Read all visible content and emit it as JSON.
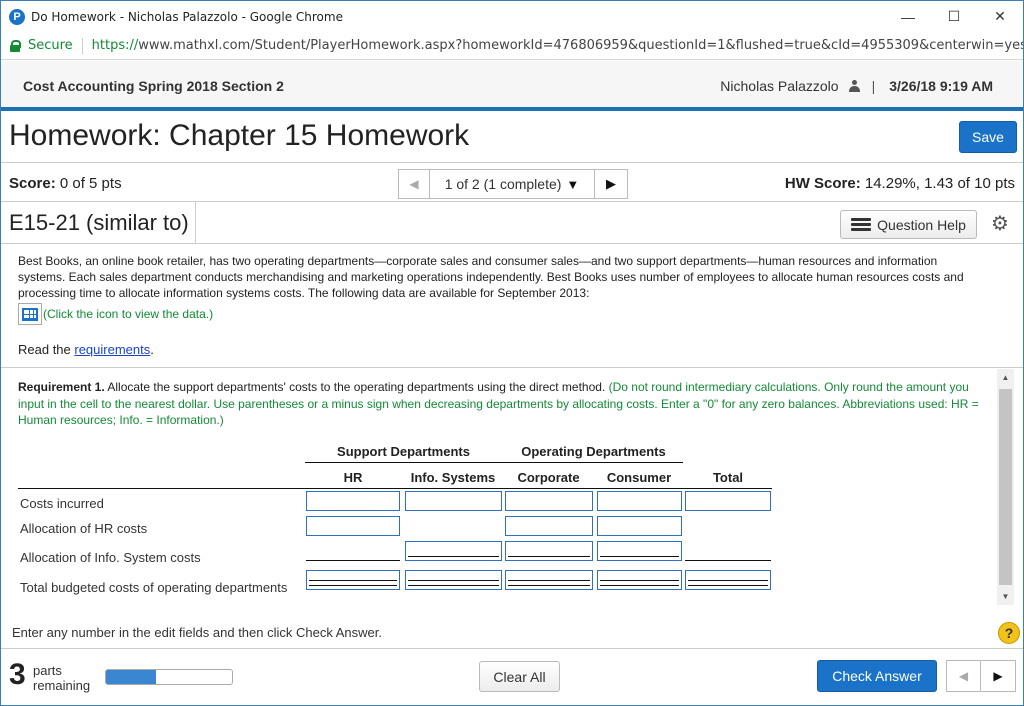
{
  "browser": {
    "window_title": "Do Homework - Nicholas Palazzolo - Google Chrome",
    "secure_label": "Secure",
    "url_scheme": "https://",
    "url_rest": "www.mathxl.com/Student/PlayerHomework.aspx?homeworkId=476806959&questionId=1&flushed=true&cId=4955309&centerwin=yes",
    "minimize_glyph": "—",
    "maximize_glyph": "☐",
    "close_glyph": "✕"
  },
  "header": {
    "course": "Cost Accounting Spring 2018 Section 2",
    "user": "Nicholas Palazzolo",
    "separator": "|",
    "datetime": "3/26/18 9:19 AM"
  },
  "homework": {
    "title": "Homework: Chapter 15 Homework",
    "save_label": "Save",
    "score_label": "Score:",
    "score_value": "0 of 5 pts",
    "nav_position": "1 of 2 (1 complete)",
    "hw_score_label": "HW Score:",
    "hw_score_value": "14.29%, 1.43 of 10 pts",
    "question_id": "E15-21 (similar to)",
    "question_help_label": "Question Help"
  },
  "question": {
    "intro": "Best Books, an online book retailer, has two operating departments—corporate sales and consumer sales—and two support departments—human resources and information systems. Each sales department conducts merchandising and marketing operations independently. Best Books uses number of employees to allocate human resources costs and processing time to allocate information systems costs. The following data are available for September 2013:",
    "data_link": "(Click the icon to view the data.)",
    "read_prefix": "Read the ",
    "requirements_link": "requirements",
    "read_suffix": ".",
    "req_label": "Requirement 1.",
    "req_text": " Allocate the support departments' costs to the operating departments using the direct method. ",
    "req_note": "(Do not round intermediary calculations. Only round the amount you input in the cell to the nearest dollar. Use parentheses or a minus sign when decreasing departments by allocating costs. Enter a \"0\" for any zero balances. Abbreviations used: HR = Human resources; Info. = Information.)"
  },
  "table": {
    "group_support": "Support Departments",
    "group_operating": "Operating Departments",
    "columns": [
      "HR",
      "Info. Systems",
      "Corporate",
      "Consumer",
      "Total"
    ],
    "rows": [
      "Costs incurred",
      "Allocation of HR costs",
      "Allocation of Info. System costs",
      "Total budgeted costs of operating departments"
    ]
  },
  "footer": {
    "instruction": "Enter any number in the edit fields and then click Check Answer.",
    "help_glyph": "?",
    "parts_count": "3",
    "parts_label_1": "parts",
    "parts_label_2": "remaining",
    "progress_fraction": 0.4,
    "clear_label": "Clear All",
    "check_label": "Check Answer"
  },
  "colors": {
    "accent": "#1a73c8",
    "secure_green": "#138a36",
    "link_blue": "#1a44c8",
    "help_yellow": "#f2c21a"
  }
}
